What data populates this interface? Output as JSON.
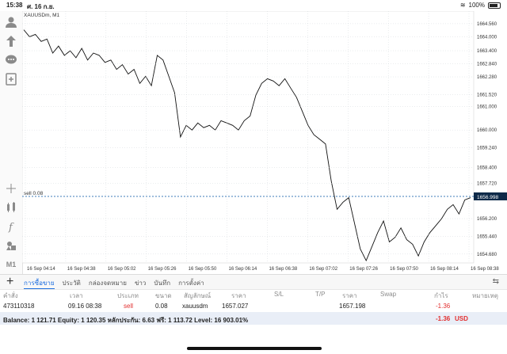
{
  "status_bar": {
    "time": "15:38",
    "date": "ศ. 16 ก.ย.",
    "battery": "100%"
  },
  "chart": {
    "symbol_label": "XAUUSDm, M1",
    "sell_label": "sell 0.08",
    "current_price_tag": "1656.998",
    "timeframe_badge": "M1",
    "colors": {
      "line": "#111111",
      "price_tag_bg": "#0e2a49",
      "sell_line": "#3f7db9",
      "grid": "#c9d0d6"
    }
  },
  "chart_data": {
    "type": "line",
    "title": "XAUUSDm, M1",
    "x": [
      "16 Sep 04:14",
      "16 Sep 04:38",
      "16 Sep 05:02",
      "16 Sep 05:26",
      "16 Sep 05:50",
      "16 Sep 06:14",
      "16 Sep 06:38",
      "16 Sep 07:02",
      "16 Sep 07:26",
      "16 Sep 07:50",
      "16 Sep 08:14",
      "16 Sep 08:38"
    ],
    "y_ticks": [
      "1664.560",
      "1664.000",
      "1663.400",
      "1662.840",
      "1662.280",
      "1661.520",
      "1661.000",
      "1660.000",
      "1659.240",
      "1658.400",
      "1657.720",
      "1656.200",
      "1655.440",
      "1654.680"
    ],
    "series": [
      {
        "values": [
          1664.3,
          1664.0,
          1664.1,
          1663.8,
          1663.9,
          1663.3,
          1663.6,
          1663.2,
          1663.4,
          1663.1,
          1663.5,
          1663.0,
          1663.3,
          1663.2,
          1662.9,
          1663.0,
          1662.6,
          1662.8,
          1662.4,
          1662.6,
          1662.0,
          1662.3,
          1661.9,
          1663.2,
          1663.0,
          1662.3,
          1661.6,
          1659.7,
          1660.2,
          1660.0,
          1660.3,
          1660.1,
          1660.2,
          1660.0,
          1660.4,
          1660.3,
          1660.2,
          1660.0,
          1660.4,
          1660.6,
          1661.5,
          1662.0,
          1662.2,
          1662.1,
          1661.9,
          1662.2,
          1661.8,
          1661.4,
          1660.8,
          1660.2,
          1659.8,
          1659.6,
          1659.4,
          1657.8,
          1656.6,
          1656.9,
          1657.1,
          1656.0,
          1654.9,
          1654.4,
          1655.0,
          1655.6,
          1656.1,
          1655.2,
          1655.4,
          1655.8,
          1655.3,
          1655.1,
          1654.6,
          1655.2,
          1655.6,
          1655.9,
          1656.2,
          1656.6,
          1656.8,
          1656.4,
          1657.0,
          1657.1
        ]
      }
    ],
    "ylim": [
      1654.3,
      1665.1
    ],
    "grid": true
  },
  "bottom_tabs": {
    "active": "การซื้อขาย",
    "items": [
      "การซื้อขาย",
      "ประวัติ",
      "กล่องจดหมาย",
      "ข่าว",
      "บันทึก",
      "การตั้งค่า"
    ]
  },
  "table": {
    "headers": [
      "คำสั่ง",
      "เวลา",
      "ประเภท",
      "ขนาด",
      "สัญลักษณ์",
      "ราคา",
      "S/L",
      "T/P",
      "ราคา",
      "Swap",
      "กำไร",
      "หมายเหตุ"
    ],
    "row": {
      "order": "473110318",
      "time": "09.16 08:38",
      "type": "sell",
      "size": "0.08",
      "symbol": "xauusdm",
      "open_price": "1657.027",
      "sl": "",
      "tp": "",
      "current_price": "1657.198",
      "swap": "",
      "profit": "-1.36",
      "comment": ""
    },
    "balance_text": "Balance: 1 121.71 Equity: 1 120.35 หลักประกัน: 6.63 ฟรี: 1 113.72 Level: 16 903.01%",
    "balance_profit": "-1.36",
    "balance_currency": "USD"
  }
}
